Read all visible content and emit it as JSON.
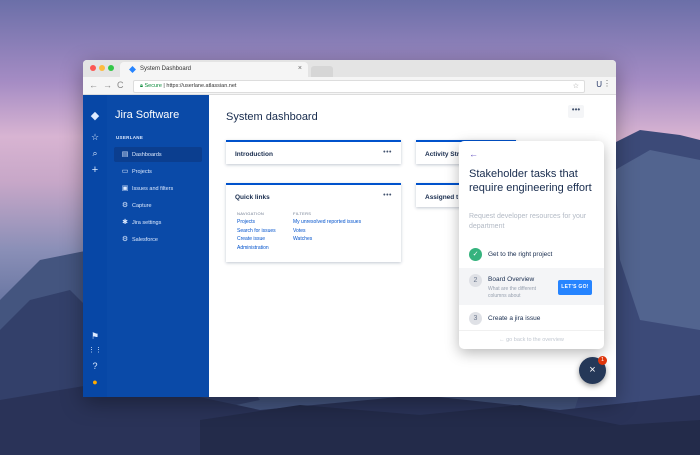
{
  "browser": {
    "tab_title": "System Dashboard",
    "tab_close": "×",
    "url_secure": "Secure",
    "url_separator": " | ",
    "url": "https://userlane.atlassian.net",
    "back": "←",
    "forward": "→",
    "reload": "C",
    "star": "☆",
    "extension": "U",
    "menu": "⋮"
  },
  "jira": {
    "product_name": "Jira Software",
    "project_name": "USERLANE",
    "sidebar_items": [
      {
        "label": "Dashboards",
        "icon": "dashboard-icon",
        "glyph": "▤",
        "active": true
      },
      {
        "label": "Projects",
        "icon": "folder-icon",
        "glyph": "▭",
        "active": false
      },
      {
        "label": "Issues and filters",
        "icon": "filter-icon",
        "glyph": "▣",
        "active": false
      },
      {
        "label": "Capture",
        "icon": "capture-icon",
        "glyph": "⚙",
        "active": false
      },
      {
        "label": "Jira settings",
        "icon": "gear-icon",
        "glyph": "✱",
        "active": false
      },
      {
        "label": "Salesforce",
        "icon": "salesforce-icon",
        "glyph": "⚙",
        "active": false
      }
    ],
    "rail_icons": {
      "logo": "◆",
      "star": "☆",
      "search": "⌕",
      "create": "+",
      "notifications": "⚑",
      "apps": "⋮⋮",
      "help": "?",
      "profile": "●"
    },
    "page_title": "System dashboard",
    "more_label": "•••",
    "gadgets": {
      "introduction": "Introduction",
      "activity": "Activity Str",
      "quick_links": "Quick links",
      "assigned": "Assigned t"
    },
    "quick_links": {
      "nav_header": "NAVIGATION",
      "nav_links": [
        "Projects",
        "Search for issues",
        "Create issue",
        "Administration"
      ],
      "filters_header": "FILTERS",
      "filter_links": [
        "My unresolved reported issues",
        "Votes",
        "Watches"
      ]
    }
  },
  "userlane": {
    "back": "←",
    "title": "Stakeholder tasks that require engineering effort",
    "subtitle": "Request developer resources for your department",
    "steps": [
      {
        "num": "✓",
        "label": "Get to the right project",
        "done": true
      },
      {
        "num": "2",
        "label": "Board Overview",
        "desc": "What are the different columns about",
        "button": "LET'S GO!"
      },
      {
        "num": "3",
        "label": "Create a jira issue"
      }
    ],
    "footer": "← go back to the overview",
    "fab": "×",
    "badge": "1"
  },
  "colors": {
    "jira_blue": "#0747a6",
    "userlane_blue": "#2684ff",
    "success": "#36b37e"
  }
}
